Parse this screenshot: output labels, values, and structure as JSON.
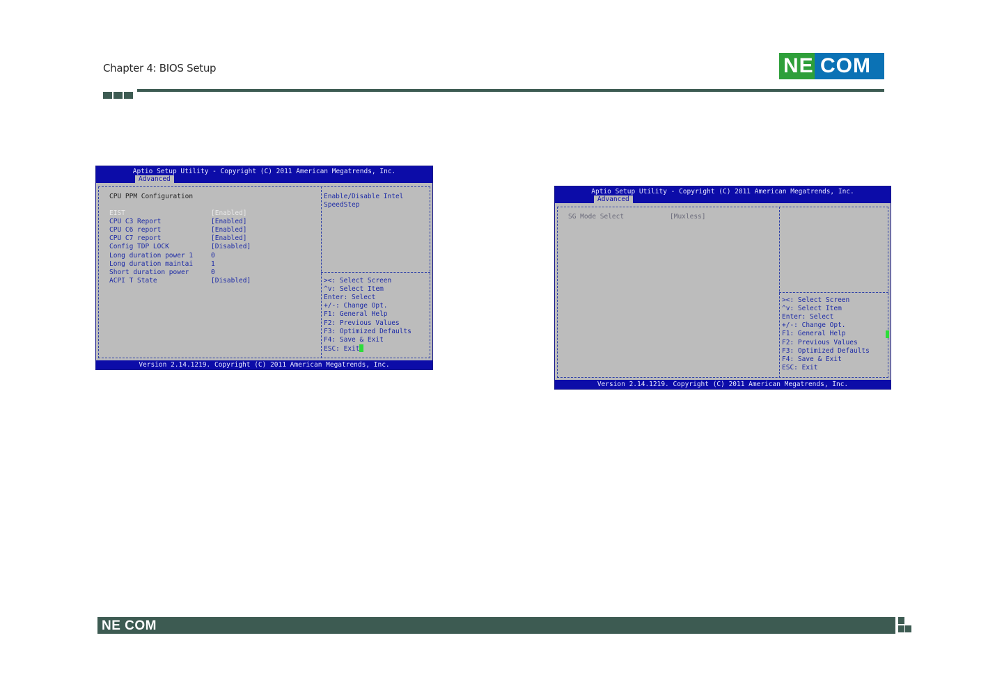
{
  "page": {
    "chapter_title": "Chapter 4: BIOS Setup",
    "brand": "NE COM",
    "footer_brand": "NE COM"
  },
  "colors": {
    "accent_green": "#2e9f3a",
    "accent_blue": "#0b72b5",
    "band": "#3d5b52",
    "bios_blue": "#0c0ca8",
    "bios_gray": "#bcbcbc"
  },
  "screen1": {
    "title": "Aptio Setup Utility - Copyright (C) 2011 American Megatrends, Inc.",
    "tab": "Advanced",
    "section": "CPU PPM Configuration",
    "rows": [
      {
        "label": "EIST",
        "value": "[Enabled]"
      },
      {
        "label": "CPU C3 Report",
        "value": "[Enabled]"
      },
      {
        "label": "CPU C6 report",
        "value": "[Enabled]"
      },
      {
        "label": "CPU C7 report",
        "value": "[Enabled]"
      },
      {
        "label": "Config TDP LOCK",
        "value": "[Disabled]"
      },
      {
        "label": "Long duration power 1",
        "value": "0"
      },
      {
        "label": "Long duration maintai",
        "value": "1"
      },
      {
        "label": "Short duration power",
        "value": "0"
      },
      {
        "label": "ACPI T State",
        "value": "[Disabled]"
      }
    ],
    "help": [
      "Enable/Disable Intel",
      "SpeedStep"
    ],
    "keys": [
      "><: Select Screen",
      "^v: Select Item",
      "Enter: Select",
      "+/-: Change Opt.",
      "F1: General Help",
      "F2: Previous Values",
      "F3: Optimized Defaults",
      "F4: Save & Exit",
      "ESC: Exit"
    ],
    "footer": "Version 2.14.1219. Copyright (C) 2011 American Megatrends, Inc."
  },
  "screen2": {
    "title": "Aptio Setup Utility - Copyright (C) 2011 American Megatrends, Inc.",
    "tab": "Advanced",
    "rows": [
      {
        "label": "SG Mode Select",
        "value": "[Muxless]"
      }
    ],
    "keys": [
      "><: Select Screen",
      "^v: Select Item",
      "Enter: Select",
      "+/-: Change Opt.",
      "F1: General Help",
      "F2: Previous Values",
      "F3: Optimized Defaults",
      "F4: Save & Exit",
      "ESC: Exit"
    ],
    "footer": "Version 2.14.1219. Copyright (C) 2011 American Megatrends, Inc."
  }
}
